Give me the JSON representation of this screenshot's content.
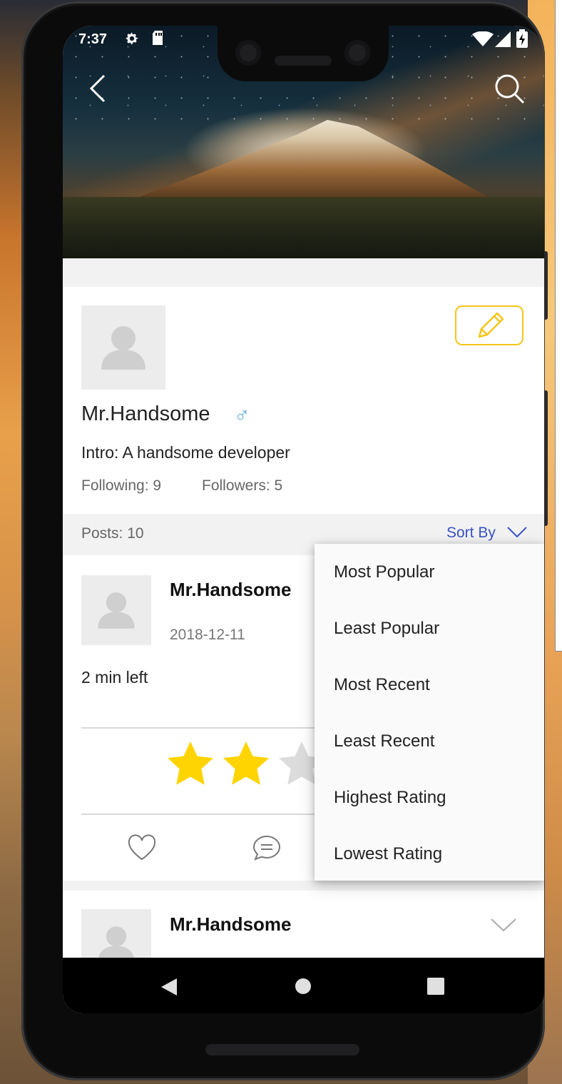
{
  "status_bar": {
    "time": "7:37"
  },
  "profile": {
    "name": "Mr.Handsome",
    "gender_symbol": "♂",
    "intro": "Intro: A handsome developer",
    "following": "Following: 9",
    "followers": "Followers: 5"
  },
  "posts_bar": {
    "count": "Posts: 10",
    "sort_label": "Sort By"
  },
  "posts": [
    {
      "author": "Mr.Handsome",
      "date": "2018-12-11",
      "text": "2 min left",
      "rating": 2
    },
    {
      "author": "Mr.Handsome"
    }
  ],
  "sort_menu": {
    "options": [
      "Most Popular",
      "Least Popular",
      "Most Recent",
      "Least Recent",
      "Highest Rating",
      "Lowest Rating"
    ]
  },
  "colors": {
    "accent": "#3a52c4",
    "star": "#ffd400",
    "edit_border": "#f5c518",
    "gender": "#5fb3e0"
  },
  "icons": [
    "back-icon",
    "search-icon",
    "edit-pencil-icon",
    "avatar-placeholder-icon",
    "like-heart-icon",
    "comment-icon",
    "star-icon",
    "chevron-down-icon",
    "nav-back-icon",
    "nav-home-icon",
    "nav-recents-icon"
  ]
}
